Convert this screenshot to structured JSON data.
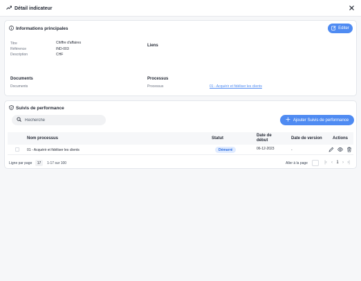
{
  "header": {
    "title": "Détail indicateur"
  },
  "info": {
    "title": "Informations principales",
    "edit_label": "Editer",
    "fields": [
      {
        "label": "Titre",
        "value": "Chiffre d'affaires"
      },
      {
        "label": "Référence",
        "value": "IND-003"
      },
      {
        "label": "Description",
        "value": "CHF"
      }
    ],
    "liens_title": "Liens",
    "documents_title": "Documents",
    "documents_label": "Documents",
    "processus_title": "Processus",
    "processus_label": "Processus",
    "processus_value": "01 - Acquérir et fidéliser les clients"
  },
  "suivis": {
    "title": "Suivis de performance",
    "search_placeholder": "Recherche",
    "add_label": "Ajouter Suivis de performance",
    "columns": {
      "nom": "Nom processus",
      "statut": "Statut",
      "date_debut": "Date de début",
      "date_version": "Date de version",
      "actions": "Actions"
    },
    "rows": [
      {
        "nom": "01 - Acquérir et fidéliser les clients",
        "statut": "Démarré",
        "date_debut": "06-12-2023",
        "date_version": "-"
      }
    ],
    "pagination": {
      "rows_per_page_label": "Ligne par page",
      "rows_per_page": "17",
      "range": "1-17 sur 100",
      "goto_label": "Aller à la page",
      "current_page": "1"
    }
  },
  "colors": {
    "accent": "#4f8bf2",
    "badge_bg": "#e0ebff",
    "badge_text": "#2f6fe0"
  }
}
